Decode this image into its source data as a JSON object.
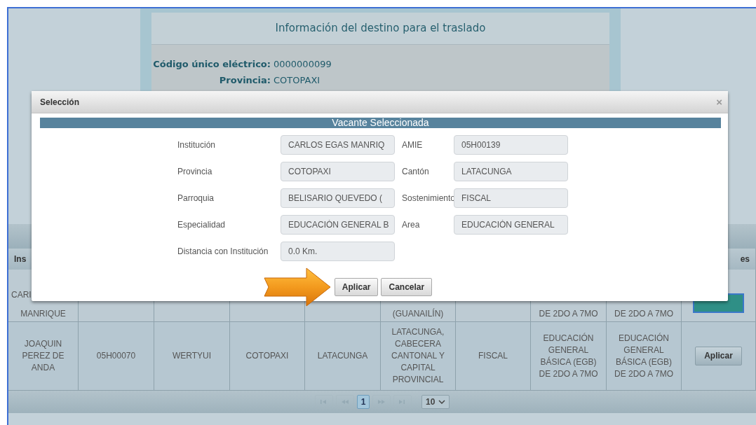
{
  "destination_panel": {
    "title": "Información del destino para el traslado",
    "fields": [
      {
        "label": "Código único eléctrico:",
        "value": "0000000099"
      },
      {
        "label": "Provincia:",
        "value": "COTOPAXI"
      }
    ]
  },
  "table": {
    "header_start": "Ins",
    "header_end": "es",
    "partial_row": {
      "name_start": "CARI",
      "name_end": "MANRIQUE",
      "parish_end": "(GUANAILÍN)",
      "specialty_end": "DE 2DO A 7MO",
      "area_end": "DE 2DO A 7MO"
    },
    "rows": [
      {
        "cells": [
          "JOAQUIN PEREZ DE ANDA",
          "05H00070",
          "WERTYUI",
          "COTOPAXI",
          "LATACUNGA",
          "LATACUNGA, CABECERA CANTONAL Y CAPITAL PROVINCIAL",
          "FISCAL",
          "EDUCACIÓN GENERAL BÁSICA (EGB) DE 2DO A 7MO",
          "EDUCACIÓN GENERAL BÁSICA (EGB) DE 2DO A 7MO"
        ],
        "action": "Aplicar"
      }
    ],
    "pager": {
      "nav": [
        {
          "kind": "first",
          "disabled": true
        },
        {
          "kind": "prev",
          "disabled": true
        },
        {
          "kind": "page",
          "label": "1",
          "selected": true
        },
        {
          "kind": "next",
          "disabled": true
        },
        {
          "kind": "last",
          "disabled": true
        }
      ],
      "page_size": "10"
    }
  },
  "dialog": {
    "title": "Selección",
    "close": "×",
    "section": "Vacante Seleccionada",
    "fields": [
      {
        "label": "Institución",
        "value": "CARLOS EGAS MANRIQ"
      },
      {
        "label": "AMIE",
        "value": "05H00139"
      },
      {
        "label": "Provincia",
        "value": "COTOPAXI"
      },
      {
        "label": "Cantón",
        "value": "LATACUNGA"
      },
      {
        "label": "Parroquia",
        "value": "BELISARIO QUEVEDO ("
      },
      {
        "label": "Sostenimiento",
        "value": "FISCAL"
      },
      {
        "label": "Especialidad",
        "value": "EDUCACIÓN GENERAL B"
      },
      {
        "label": "Area",
        "value": "EDUCACIÓN GENERAL"
      },
      {
        "label": "Distancia con Institución",
        "value": "0.0 Km."
      }
    ],
    "buttons": [
      "Aplicar",
      "Cancelar"
    ]
  }
}
